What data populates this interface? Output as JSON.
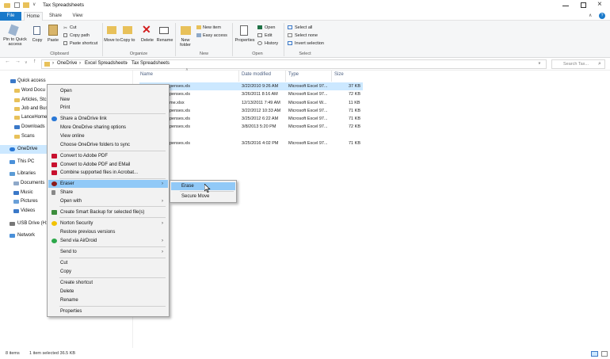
{
  "window": {
    "title": "Tax Spreadsheets",
    "minimize_icon": "minimize-icon",
    "maximize_icon": "maximize-icon",
    "close_icon": "close-icon"
  },
  "tabs": [
    "File",
    "Home",
    "Share",
    "View"
  ],
  "ribbon": {
    "clipboard": {
      "pin_label": "Pin to Quick access",
      "copy_label": "Copy",
      "paste_label": "Paste",
      "cut_label": "Cut",
      "copy_path_label": "Copy path",
      "paste_shortcut_label": "Paste shortcut",
      "group_label": "Clipboard"
    },
    "organize": {
      "move_to_label": "Move to",
      "copy_to_label": "Copy to",
      "delete_label": "Delete",
      "rename_label": "Rename",
      "group_label": "Organize"
    },
    "new": {
      "new_folder_label": "New folder",
      "new_item_label": "New item",
      "easy_access_label": "Easy access",
      "group_label": "New"
    },
    "open": {
      "properties_label": "Properties",
      "open_label": "Open",
      "edit_label": "Edit",
      "history_label": "History",
      "group_label": "Open"
    },
    "select": {
      "select_all_label": "Select all",
      "select_none_label": "Select none",
      "invert_label": "Invert selection",
      "group_label": "Select"
    }
  },
  "address": {
    "crumbs": [
      "OneDrive",
      "Excel Spreadsheets",
      "Tax Spreadsheets"
    ],
    "search_placeholder": "Search Tax..."
  },
  "nav": [
    {
      "label": "Quick access"
    },
    {
      "label": "Word Docu"
    },
    {
      "label": "Articles, Stc"
    },
    {
      "label": "Job and Bus"
    },
    {
      "label": "LanceHome"
    },
    {
      "label": "Downloads"
    },
    {
      "label": "Scans"
    },
    {
      "label": "OneDrive"
    },
    {
      "label": "This PC"
    },
    {
      "label": "Libraries"
    },
    {
      "label": "Documents"
    },
    {
      "label": "Music"
    },
    {
      "label": "Pictures"
    },
    {
      "label": "Videos"
    },
    {
      "label": "USB Drive (H:)"
    },
    {
      "label": "Network"
    }
  ],
  "columns": {
    "name": "Name",
    "date": "Date modified",
    "type": "Type",
    "size": "Size"
  },
  "files": [
    {
      "name": "penses.xls",
      "date": "3/22/2010 9:26 AM",
      "type": "Microsoft Excel 97...",
      "size": "37 KB"
    },
    {
      "name": "penses.xls",
      "date": "3/26/2011 8:16 AM",
      "type": "Microsoft Excel 97...",
      "size": "72 KB"
    },
    {
      "name": "me.xlsx",
      "date": "12/13/2011 7:49 AM",
      "type": "Microsoft Excel W...",
      "size": "11 KB"
    },
    {
      "name": "penses.xls",
      "date": "3/22/2012 10:33 AM",
      "type": "Microsoft Excel 97...",
      "size": "71 KB"
    },
    {
      "name": "penses.xls",
      "date": "3/25/2012 6:22 AM",
      "type": "Microsoft Excel 97...",
      "size": "71 KB"
    },
    {
      "name": "penses.xls",
      "date": "3/8/2013 5:20 PM",
      "type": "Microsoft Excel 97...",
      "size": "72 KB"
    },
    {
      "name": "penses.xls",
      "date": "3/25/2016 4:02 PM",
      "type": "Microsoft Excel 97...",
      "size": "71 KB"
    }
  ],
  "context_menu": {
    "items": [
      "Open",
      "New",
      "Print",
      "Share a OneDrive link",
      "More OneDrive sharing options",
      "View online",
      "Choose OneDrive folders to sync",
      "Convert to Adobe PDF",
      "Convert to Adobe PDF and EMail",
      "Combine supported files in Acrobat...",
      "Eraser",
      "Share",
      "Open with",
      "Create Smart Backup for selected file(s)",
      "Norton Security",
      "Restore previous versions",
      "Send via AirDroid",
      "Send to",
      "Cut",
      "Copy",
      "Create shortcut",
      "Delete",
      "Rename",
      "Properties"
    ],
    "highlight": "Eraser"
  },
  "submenu": {
    "items": [
      "Erase",
      "Secure Move"
    ],
    "highlight": "Erase"
  },
  "status": {
    "count": "8 items",
    "selected": "1 item selected  36.5 KB"
  },
  "colors": {
    "accent": "#1979ca",
    "selection": "#cce8ff",
    "menu_highlight": "#91c9f7"
  }
}
